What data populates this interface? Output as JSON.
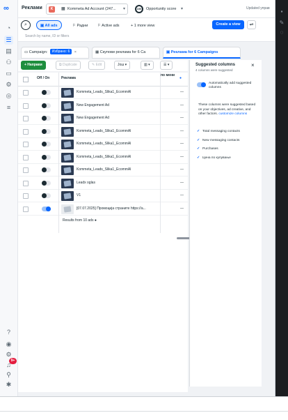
{
  "topbar": {
    "title": "Реклами",
    "account_name": "Kommeta Ad Account (247...",
    "account_badge": "K",
    "opportunity_score": "100",
    "opportunity_label": "Opportunity score",
    "updated": "Updated управ"
  },
  "filters": {
    "all_ads": "All ads",
    "pill2": "Радни",
    "active_ads": "Active ads",
    "more_view": "1 more view",
    "create_view": "Create a view"
  },
  "search": {
    "placeholder": "Search by name, ID or filters"
  },
  "tabs": [
    {
      "label": "Campaign:",
      "tag": "Избрано: 6"
    },
    {
      "label": "Скупови реклама for 6 Ca"
    },
    {
      "label": "Реклама for 6 Campaigns"
    }
  ],
  "toolbar": {
    "create": "+ Направи",
    "duplicate": "Duplicate",
    "edit": "Edit",
    "more": "Још",
    "columns_icon": "columns-icon",
    "breakdown_icon": "breakdown-icon"
  },
  "table": {
    "col_off_on": "Off / On",
    "col_ad": "Реклама",
    "col_extra": "по мени",
    "rows": [
      {
        "name": "Kommeta_Leads_Slika1_EcommAl",
        "on": false,
        "thumb": "dark"
      },
      {
        "name": "New Engagement Ad",
        "on": false,
        "thumb": "dark"
      },
      {
        "name": "New Engagement Ad",
        "on": false,
        "thumb": "dark"
      },
      {
        "name": "Kommeta_Leads_Slika1_EcommAl",
        "on": false,
        "thumb": "dark"
      },
      {
        "name": "Kommeta_Leads_Slika1_EcommAl",
        "on": false,
        "thumb": "dark"
      },
      {
        "name": "Kommeta_Leads_Slika1_EcommAl",
        "on": false,
        "thumb": "dark"
      },
      {
        "name": "Kommeta_Leads_Slika1_EcommAl",
        "on": false,
        "thumb": "dark"
      },
      {
        "name": "Leadx oglas",
        "on": false,
        "thumb": "dark"
      },
      {
        "name": "V1",
        "on": false,
        "thumb": "dark"
      },
      {
        "name": "[07.07.2025] Промоција страните https://a...",
        "on": true,
        "thumb": "light"
      }
    ],
    "dash": "—",
    "results": "Results from 10 ads"
  },
  "panel": {
    "title": "Suggested columns",
    "subtitle": "4 columns were suggested",
    "auto_add": "Automatically add suggested columns",
    "desc_1": "These columns were suggested based on your objectives, ad creative, and other factors.",
    "desc_link": "customize columns",
    "suggestions": [
      "Total messaging contacts",
      "New messaging contacts",
      "Purchases",
      "Цена по купување"
    ]
  },
  "rail": {
    "notification_count": "9+"
  },
  "colors": {
    "accent": "#0866ff",
    "create_green": "#1e8e3e"
  }
}
